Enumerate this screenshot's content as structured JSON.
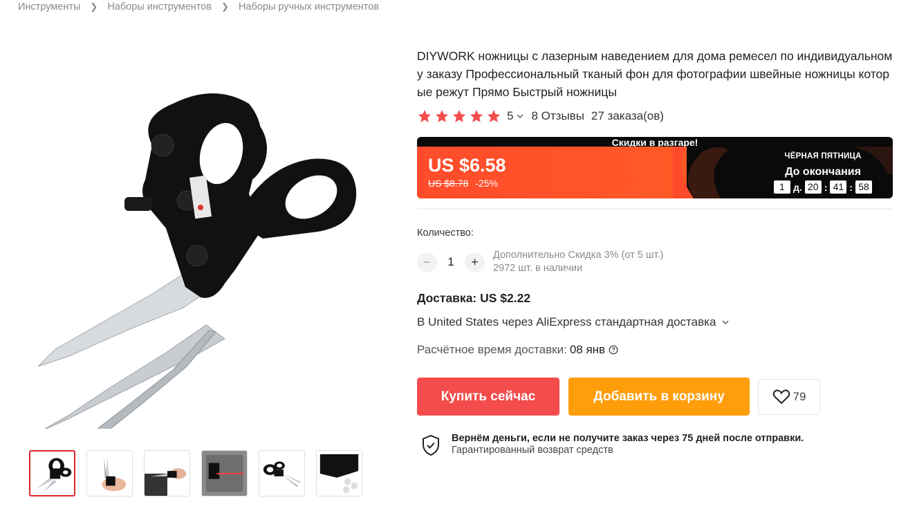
{
  "breadcrumb": [
    "Инструменты",
    "Наборы инструментов",
    "Наборы ручных инструментов"
  ],
  "product": {
    "title": "DIYWORK ножницы с лазерным наведением для дома ремесел по индивидуальному заказу Профессиональный тканый фон для фотографии швейные ножницы которые режут Прямо Быстрый ножницы",
    "rating": "5",
    "stars": 5,
    "reviews": "8 Отзывы",
    "orders": "27 заказа(ов)"
  },
  "promo": {
    "header": "Скидки в разгаре!",
    "price": "US $6.58",
    "old_price": "US $8.78",
    "discount": "-25%",
    "event_title": "ЧЁРНАЯ ПЯТНИЦА",
    "until_label": "До окончания",
    "timer": {
      "days": "1",
      "days_label": "д.",
      "hours": "20",
      "minutes": "41",
      "seconds": "58"
    },
    "colors": {
      "accent": "#ff4b2b",
      "dark": "#0a0a0a"
    }
  },
  "quantity": {
    "label": "Количество:",
    "value": "1",
    "minus": "−",
    "plus": "+",
    "bulk_discount": "Дополнительно Скидка 3% (от 5 шт.)",
    "stock": "2972 шт. в наличии"
  },
  "shipping": {
    "cost": "Доставка: US $2.22",
    "method": "В United States через AliExpress стандартная доставка",
    "time_label": "Расчётное время доставки:",
    "time_value": "08 янв"
  },
  "actions": {
    "buy": "Купить сейчас",
    "cart": "Добавить в корзину",
    "wishlist_count": "79",
    "colors": {
      "buy": "#f44c4c",
      "cart": "#ff9d0a"
    }
  },
  "guarantee": {
    "title": "Вернём деньги, если не получите заказ через 75 дней после отправки.",
    "subtitle": "Гарантированный возврат средств"
  },
  "gallery": {
    "thumbnail_count": 6,
    "selected_index": 0
  }
}
